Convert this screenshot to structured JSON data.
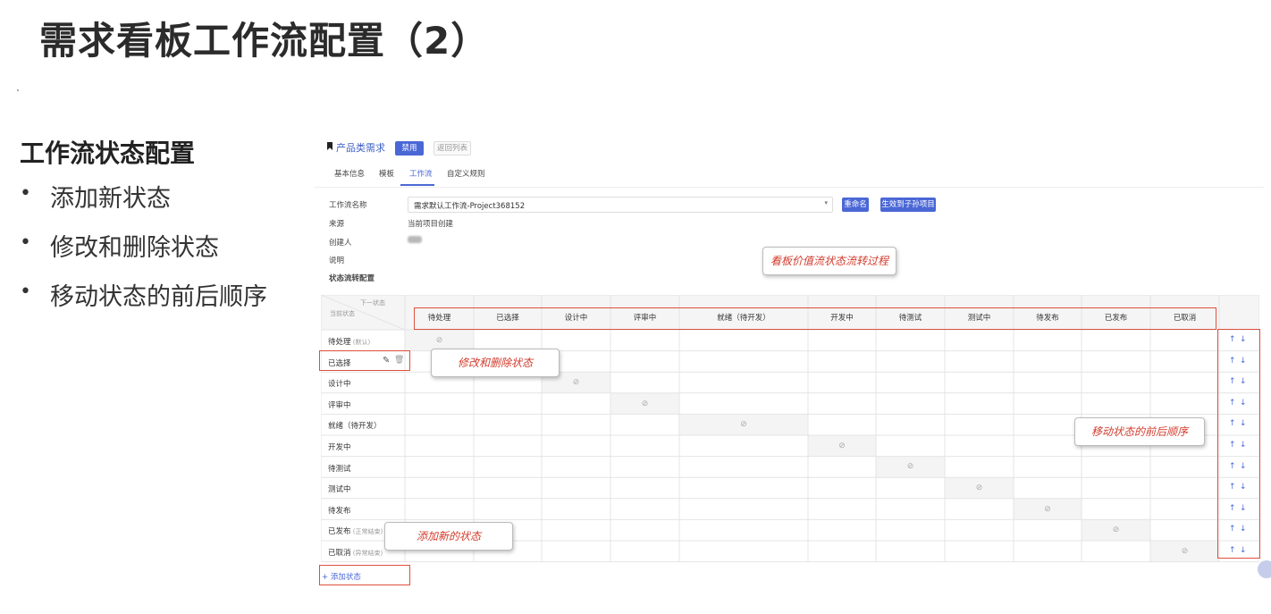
{
  "slide": {
    "title": "需求看板工作流配置（2）",
    "section_title": "工作流状态配置",
    "bullets": [
      "添加新状态",
      "修改和删除状态",
      "移动状态的前后顺序"
    ]
  },
  "app": {
    "product_name": "产品类需求",
    "disable_button": "禁用",
    "back_button": "返回列表",
    "tabs": [
      {
        "label": "基本信息",
        "active": false
      },
      {
        "label": "模板",
        "active": false
      },
      {
        "label": "工作流",
        "active": true
      },
      {
        "label": "自定义规则",
        "active": false
      }
    ],
    "form": {
      "workflow_name_label": "工作流名称",
      "workflow_name_value": "需求默认工作流-Project368152",
      "rename_button": "重命名",
      "apply_children_button": "生效到子孙项目",
      "source_label": "来源",
      "source_value": "当前项目创建",
      "creator_label": "创建人",
      "description_label": "说明",
      "transition_label": "状态流转配置"
    },
    "grid": {
      "corner_next": "下一状态",
      "corner_current": "当前状态",
      "columns": [
        "待处理",
        "已选择",
        "设计中",
        "评审中",
        "就绪（待开发）",
        "开发中",
        "待测试",
        "测试中",
        "待发布",
        "已发布",
        "已取消"
      ],
      "rows": [
        {
          "label": "待处理",
          "tag": "(默认)"
        },
        {
          "label": "已选择",
          "tag": ""
        },
        {
          "label": "设计中",
          "tag": ""
        },
        {
          "label": "评审中",
          "tag": ""
        },
        {
          "label": "就绪（待开发）",
          "tag": ""
        },
        {
          "label": "开发中",
          "tag": ""
        },
        {
          "label": "待测试",
          "tag": ""
        },
        {
          "label": "测试中",
          "tag": ""
        },
        {
          "label": "待发布",
          "tag": ""
        },
        {
          "label": "已发布",
          "tag": "(正常结束)"
        },
        {
          "label": "已取消",
          "tag": "(异常结束)"
        }
      ],
      "edit_icon": "pencil-icon",
      "delete_icon": "trash-icon",
      "disabled_icon": "⊘",
      "move_up_icon": "arrow-up-icon",
      "move_down_icon": "arrow-down-icon"
    },
    "add_state_label": "+ 添加状态"
  },
  "annotations": {
    "value_flow": "看板价值流状态流转过程",
    "edit_delete": "修改和删除状态",
    "move_order": "移动状态的前后顺序",
    "add_new": "添加新的状态"
  },
  "colors": {
    "accent": "#4a67d6",
    "highlight_red": "#e0503e",
    "callout_text": "#d23b2c"
  }
}
